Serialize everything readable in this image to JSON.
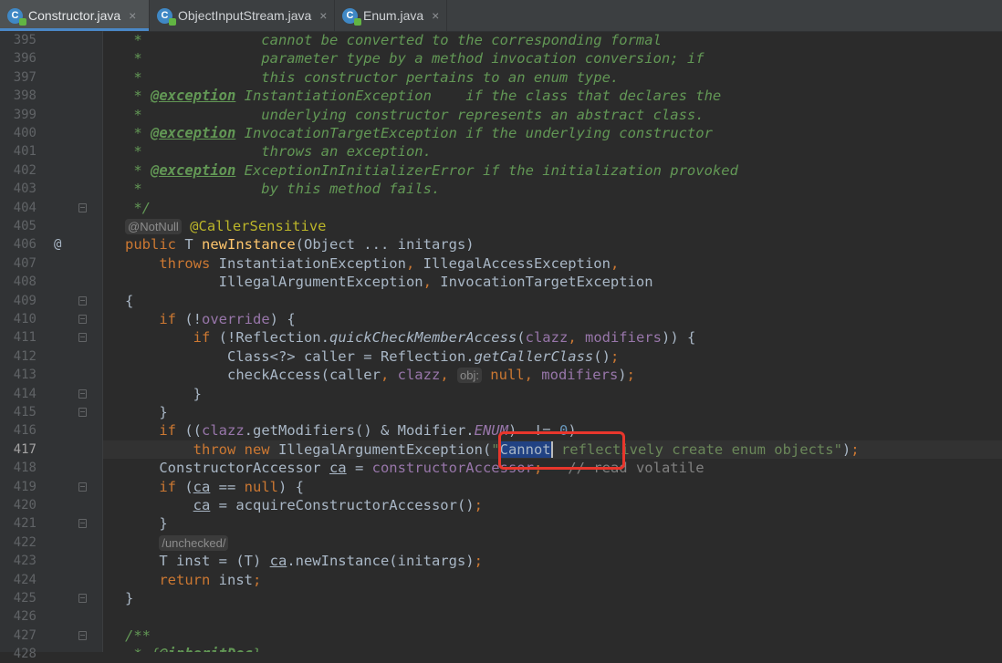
{
  "tabs": [
    {
      "label": "Constructor.java",
      "active": true
    },
    {
      "label": "ObjectInputStream.java",
      "active": false
    },
    {
      "label": "Enum.java",
      "active": false
    }
  ],
  "tab_close_glyph": "×",
  "tab_icon_letter": "C",
  "gutter_marker": "@",
  "hints": {
    "notnull": "@NotNull",
    "obj": "obj:"
  },
  "lines": [
    {
      "n": "395",
      "tokens": [
        [
          "c",
          " *              cannot be converted to the corresponding formal"
        ]
      ]
    },
    {
      "n": "396",
      "tokens": [
        [
          "c",
          " *              parameter type by a method invocation conversion; if"
        ]
      ]
    },
    {
      "n": "397",
      "tokens": [
        [
          "c",
          " *              this constructor pertains to an enum type."
        ]
      ]
    },
    {
      "n": "398",
      "tokens": [
        [
          "c",
          " * "
        ],
        [
          "ct",
          "@exception"
        ],
        [
          "c",
          " InstantiationException    if the class that declares the"
        ]
      ]
    },
    {
      "n": "399",
      "tokens": [
        [
          "c",
          " *              underlying constructor represents an abstract class."
        ]
      ]
    },
    {
      "n": "400",
      "tokens": [
        [
          "c",
          " * "
        ],
        [
          "ct",
          "@exception"
        ],
        [
          "c",
          " InvocationTargetException if the underlying constructor"
        ]
      ]
    },
    {
      "n": "401",
      "tokens": [
        [
          "c",
          " *              throws an exception."
        ]
      ]
    },
    {
      "n": "402",
      "tokens": [
        [
          "c",
          " * "
        ],
        [
          "ct",
          "@exception"
        ],
        [
          "c",
          " ExceptionInInitializerError if the initialization provoked"
        ]
      ]
    },
    {
      "n": "403",
      "tokens": [
        [
          "c",
          " *              by this method fails."
        ]
      ]
    },
    {
      "n": "404",
      "tokens": [
        [
          "c",
          " */"
        ]
      ]
    },
    {
      "n": "405",
      "tokens": [
        [
          "hint",
          "@NotNull"
        ],
        [
          "",
          " "
        ],
        [
          "a",
          "@CallerSensitive"
        ]
      ]
    },
    {
      "n": "406",
      "tokens": [
        [
          "k",
          "public "
        ],
        [
          "",
          "T "
        ],
        [
          "m",
          "newInstance"
        ],
        [
          "",
          "(Object ... initargs)"
        ]
      ]
    },
    {
      "n": "407",
      "tokens": [
        [
          "k",
          "    throws "
        ],
        [
          "",
          "InstantiationException"
        ],
        [
          "k",
          ", "
        ],
        [
          "",
          "IllegalAccessException"
        ],
        [
          "k",
          ","
        ]
      ]
    },
    {
      "n": "408",
      "tokens": [
        [
          "",
          "           IllegalArgumentException"
        ],
        [
          "k",
          ", "
        ],
        [
          "",
          "InvocationTargetException"
        ]
      ]
    },
    {
      "n": "409",
      "tokens": [
        [
          "",
          "{"
        ]
      ]
    },
    {
      "n": "410",
      "tokens": [
        [
          "k",
          "    if "
        ],
        [
          "",
          "(!"
        ],
        [
          "f",
          "override"
        ],
        [
          "",
          ") {"
        ]
      ]
    },
    {
      "n": "411",
      "tokens": [
        [
          "k",
          "        if "
        ],
        [
          "",
          "(!Reflection."
        ],
        [
          "mi",
          "quickCheckMemberAccess"
        ],
        [
          "",
          "("
        ],
        [
          "f",
          "clazz"
        ],
        [
          "k",
          ", "
        ],
        [
          "f",
          "modifiers"
        ],
        [
          "",
          ")) {"
        ]
      ]
    },
    {
      "n": "412",
      "tokens": [
        [
          "",
          "            Class<?> caller = Reflection."
        ],
        [
          "mi",
          "getCallerClass"
        ],
        [
          "",
          "()"
        ],
        [
          "k",
          ";"
        ]
      ]
    },
    {
      "n": "413",
      "tokens": [
        [
          "",
          "            checkAccess(caller"
        ],
        [
          "k",
          ", "
        ],
        [
          "f",
          "clazz"
        ],
        [
          "k",
          ", "
        ],
        [
          "hint",
          "obj:"
        ],
        [
          "",
          " "
        ],
        [
          "k",
          "null, "
        ],
        [
          "f",
          "modifiers"
        ],
        [
          "",
          ")"
        ],
        [
          "k",
          ";"
        ]
      ]
    },
    {
      "n": "414",
      "tokens": [
        [
          "",
          "        }"
        ]
      ]
    },
    {
      "n": "415",
      "tokens": [
        [
          "",
          "    }"
        ]
      ]
    },
    {
      "n": "416",
      "tokens": [
        [
          "k",
          "    if "
        ],
        [
          "",
          "(("
        ],
        [
          "f",
          "clazz"
        ],
        [
          "",
          ".getModifiers() & Modifier."
        ],
        [
          "fi",
          "ENUM"
        ],
        [
          "",
          ")  != "
        ],
        [
          "n",
          "0"
        ],
        [
          "",
          ")"
        ]
      ]
    },
    {
      "n": "417",
      "tokens": [
        [
          "k",
          "        throw new "
        ],
        [
          "",
          "IllegalArgumentException("
        ],
        [
          "s",
          "\""
        ],
        [
          "sel",
          "Cannot"
        ],
        [
          "caret",
          ""
        ],
        [
          "s",
          " reflectively create enum objects\""
        ],
        [
          "",
          ")"
        ],
        [
          "k",
          ";"
        ]
      ]
    },
    {
      "n": "418",
      "tokens": [
        [
          "",
          "    ConstructorAccessor "
        ],
        [
          "u",
          "ca"
        ],
        [
          "",
          " = "
        ],
        [
          "f",
          "constructorAccessor"
        ],
        [
          "k",
          ";"
        ],
        [
          "",
          "   "
        ],
        [
          "g",
          "// read volatile"
        ]
      ]
    },
    {
      "n": "419",
      "tokens": [
        [
          "k",
          "    if "
        ],
        [
          "",
          "("
        ],
        [
          "u",
          "ca"
        ],
        [
          "",
          " == "
        ],
        [
          "k",
          "null"
        ],
        [
          "",
          ") {"
        ]
      ]
    },
    {
      "n": "420",
      "tokens": [
        [
          "",
          "        "
        ],
        [
          "u",
          "ca"
        ],
        [
          "",
          " = acquireConstructorAccessor()"
        ],
        [
          "k",
          ";"
        ]
      ]
    },
    {
      "n": "421",
      "tokens": [
        [
          "",
          "    }"
        ]
      ]
    },
    {
      "n": "422",
      "tokens": [
        [
          "",
          "    "
        ],
        [
          "hint",
          "/unchecked/"
        ]
      ]
    },
    {
      "n": "423",
      "tokens": [
        [
          "",
          "    T inst = (T) "
        ],
        [
          "u",
          "ca"
        ],
        [
          "",
          ".newInstance(initargs)"
        ],
        [
          "k",
          ";"
        ]
      ]
    },
    {
      "n": "424",
      "tokens": [
        [
          "k",
          "    return "
        ],
        [
          "",
          "inst"
        ],
        [
          "k",
          ";"
        ]
      ]
    },
    {
      "n": "425",
      "tokens": [
        [
          "",
          "}"
        ]
      ]
    },
    {
      "n": "426",
      "tokens": []
    },
    {
      "n": "427",
      "tokens": [
        [
          "c",
          "/**"
        ]
      ]
    },
    {
      "n": "428",
      "tokens": [
        [
          "c",
          " * {"
        ],
        [
          "ct",
          "@inheritDoc"
        ],
        [
          "c",
          "}"
        ]
      ]
    }
  ],
  "current_line": "417",
  "fold_lines": [
    "404",
    "409",
    "410",
    "411",
    "414",
    "415",
    "419",
    "421",
    "425",
    "427"
  ],
  "colors": {
    "background": "#2b2b2b",
    "keyword": "#cc7832",
    "comment": "#629755",
    "field": "#9876aa",
    "string": "#6a8759",
    "method": "#ffc66d",
    "annotation": "#bbb529",
    "highlight_box": "#e8362c"
  }
}
